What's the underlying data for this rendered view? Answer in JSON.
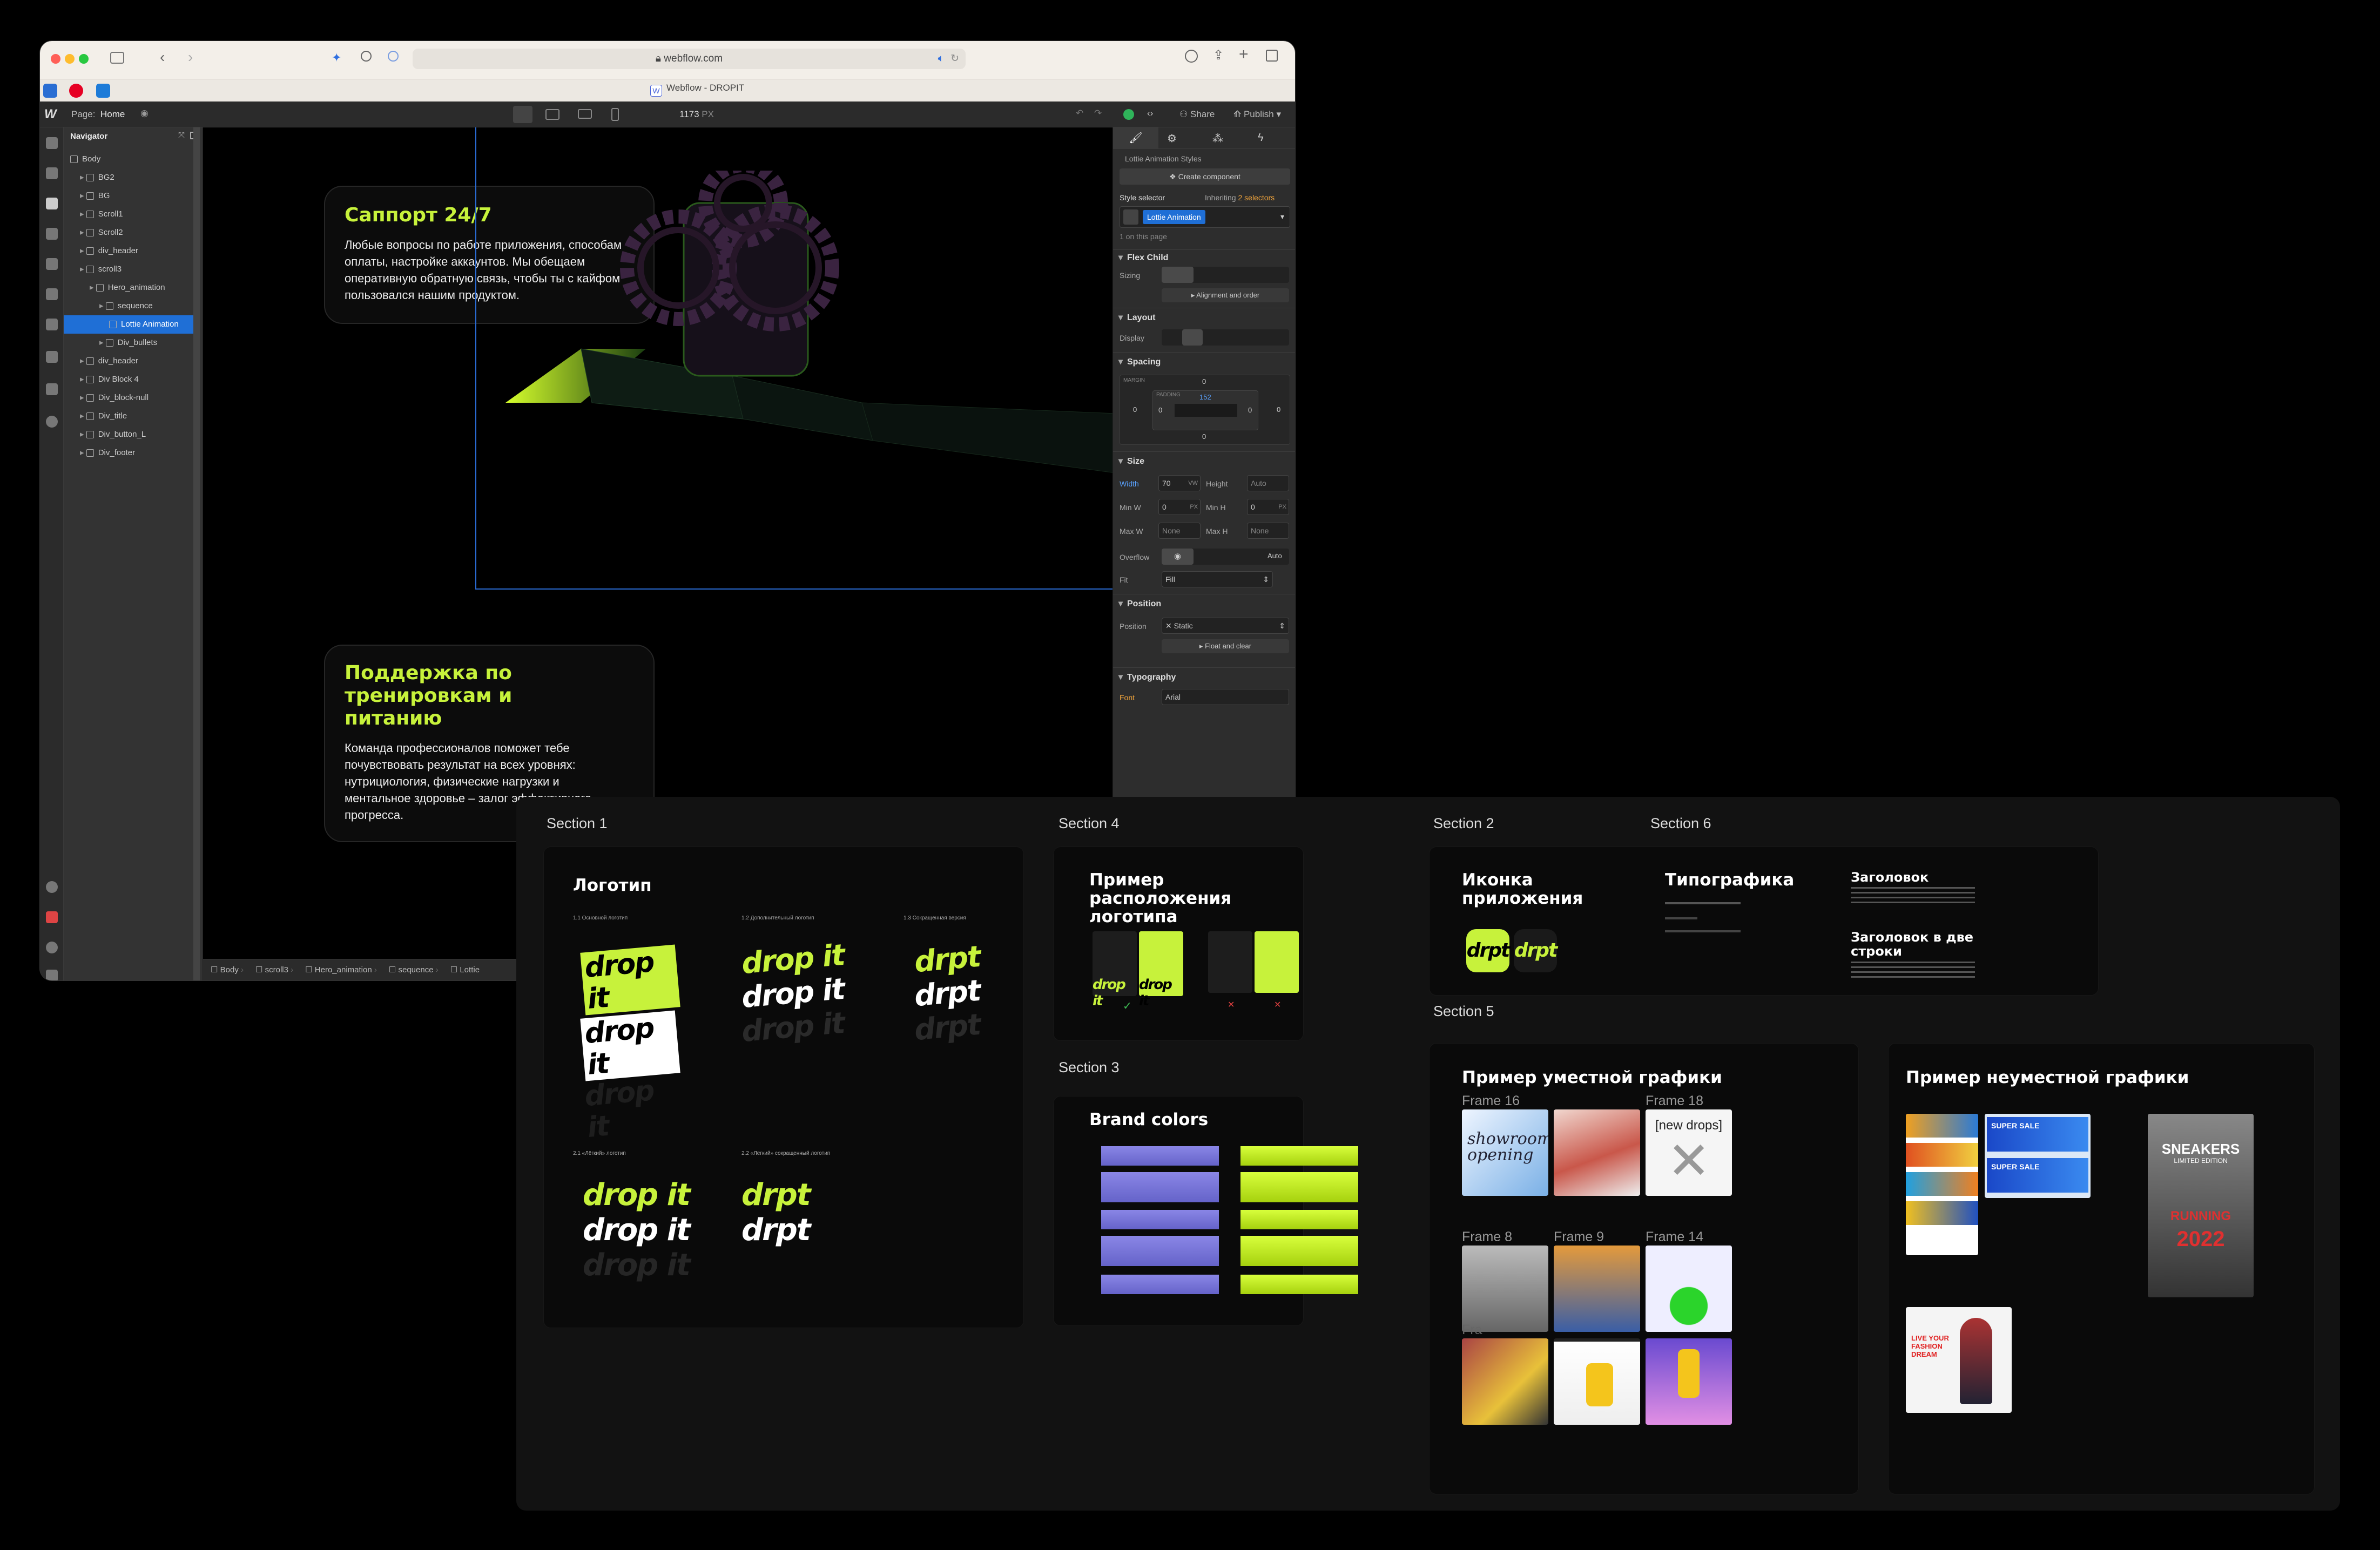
{
  "browser": {
    "url": "webflow.com",
    "tab_title": "Webflow - DROPIT",
    "tab_favicon": "W"
  },
  "webflow": {
    "page_label": "Page:",
    "page_name": "Home",
    "canvas_width": "1173",
    "canvas_unit": "PX",
    "share_label": "Share",
    "publish_label": "Publish"
  },
  "navigator": {
    "title": "Navigator",
    "items": [
      {
        "label": "Body",
        "indent": 0
      },
      {
        "label": "BG2",
        "indent": 1
      },
      {
        "label": "BG",
        "indent": 1
      },
      {
        "label": "Scroll1",
        "indent": 1
      },
      {
        "label": "Scroll2",
        "indent": 1
      },
      {
        "label": "div_header",
        "indent": 1
      },
      {
        "label": "scroll3",
        "indent": 1
      },
      {
        "label": "Hero_animation",
        "indent": 2
      },
      {
        "label": "sequence",
        "indent": 3
      },
      {
        "label": "Lottie Animation",
        "indent": 4,
        "selected": true
      },
      {
        "label": "Div_bullets",
        "indent": 3
      },
      {
        "label": "div_header",
        "indent": 1
      },
      {
        "label": "Div Block 4",
        "indent": 1
      },
      {
        "label": "Div_block-null",
        "indent": 1
      },
      {
        "label": "Div_title",
        "indent": 1
      },
      {
        "label": "Div_button_L",
        "indent": 1
      },
      {
        "label": "Div_footer",
        "indent": 1
      }
    ]
  },
  "canvas": {
    "card1_title": "Саппорт 24/7",
    "card1_text": "Любые вопросы по работе приложения, способам оплаты, настройке аккаунтов. Мы обещаем оперативную обратную связь, чтобы ты с кайфом пользовался нашим продуктом.",
    "card2_title": "Поддержка по тренировкам и питанию",
    "card2_text": "Команда профессионалов поможет тебе почувствовать результат на всех уровнях: нутрициология, физические нагрузки и ментальное здоровье – залог эффективного прогресса."
  },
  "breadcrumb": [
    "Body",
    "scroll3",
    "Hero_animation",
    "sequence",
    "Lottie"
  ],
  "right_panel": {
    "element_name": "Lottie Animation Styles",
    "create_component": "Create component",
    "style_selector_label": "Style selector",
    "inheriting": "Inheriting",
    "inheriting_count": "2 selectors",
    "selector_value": "Lottie Animation",
    "on_page": "1 on this page",
    "flex_child": "Flex Child",
    "sizing_label": "Sizing",
    "align_order": "Alignment and order",
    "layout": "Layout",
    "display_label": "Display",
    "spacing": "Spacing",
    "margin_label": "MARGIN",
    "padding_label": "PADDING",
    "padding_top": "152",
    "zero": "0",
    "size": "Size",
    "width_label": "Width",
    "width_value": "70",
    "width_unit": "VW",
    "height_label": "Height",
    "height_value": "Auto",
    "minw_label": "Min W",
    "minh_label": "Min H",
    "maxw_label": "Max W",
    "maxh_label": "Max H",
    "none": "None",
    "px": "PX",
    "overflow_label": "Overflow",
    "overflow_auto": "Auto",
    "fit_label": "Fit",
    "fit_value": "Fill",
    "position": "Position",
    "position_label": "Position",
    "position_value": "Static",
    "float_clear": "Float and clear",
    "typography": "Typography",
    "font_label": "Font",
    "font_value": "Arial"
  },
  "board": {
    "sections": {
      "s1": "Section 1",
      "s2": "Section 2",
      "s3": "Section 3",
      "s4": "Section 4",
      "s5": "Section 5",
      "s6": "Section 6"
    },
    "logo": {
      "title": "Логотип",
      "wordmark": "drop it",
      "short": "drpt",
      "cap1": "1.1 Основной логотип",
      "cap2": "1.2 Дополнительный логотип",
      "cap3": "1.3 Сокращенная версия",
      "cap4": "2.1 «Лёгкий» логотип",
      "cap5": "2.2 «Лёгкий» сокращенный логотип"
    },
    "placement_title": "Пример расположения логотипа",
    "brand_colors_title": "Brand colors",
    "app_icon_title": "Иконка приложения",
    "app_icon_text": "drpt",
    "typography_title": "Типографика",
    "heading_sample": "Заголовок",
    "heading_two_lines": "Заголовок в две строки",
    "good_graphics_title": "Пример уместной графики",
    "bad_graphics_title": "Пример неуместной графики",
    "frames": {
      "f16": "Frame 16",
      "f18": "Frame 18",
      "f8": "Frame 8",
      "f9": "Frame 9",
      "f14": "Frame 14",
      "fr": "Fra"
    },
    "img_text": {
      "showroom": "showroom opening",
      "newdrops": "[new drops]",
      "supersale": "SUPER SALE",
      "sneakers": "SNEAKERS",
      "limited": "LIMITED EDITION",
      "running": "RUNNING",
      "year": "2022",
      "live": "LIVE YOUR FASHION DREAM"
    }
  },
  "colors": {
    "accent": "#c7f23b",
    "lavender": "#7b78d8",
    "webflow_blue": "#1f6fd6"
  }
}
